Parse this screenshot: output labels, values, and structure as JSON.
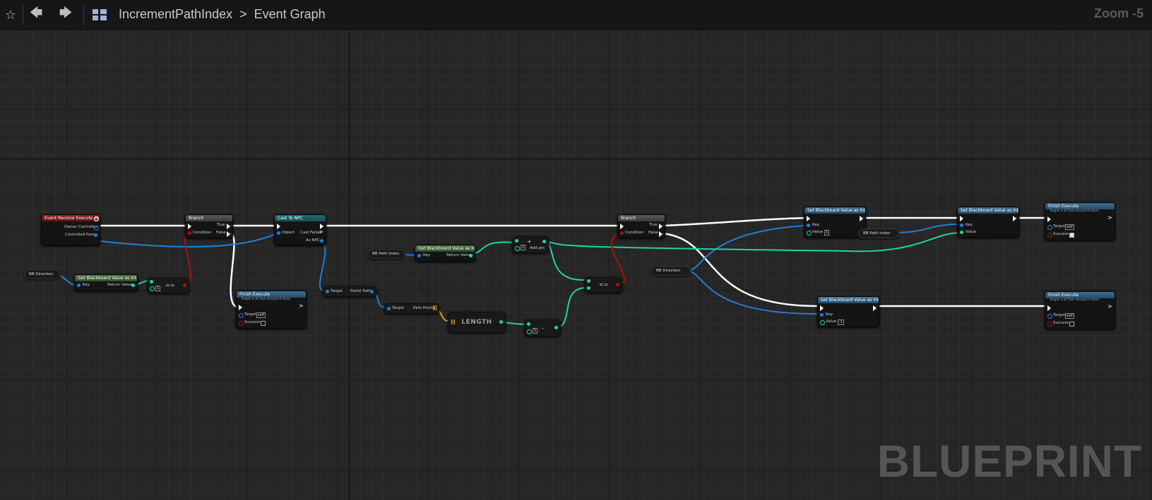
{
  "toolbar": {
    "favorite_icon": "star-icon",
    "back_icon": "arrow-left-icon",
    "forward_icon": "arrow-right-icon",
    "graph_icon": "graph-icon",
    "breadcrumb_root": "IncrementPathIndex",
    "breadcrumb_sep": ">",
    "breadcrumb_leaf": "Event Graph",
    "zoom": "Zoom -5"
  },
  "watermark": "BLUEPRINT",
  "nodes": {
    "event": {
      "title": "Event Receive Execute AI",
      "owner": "Owner Controller",
      "pawn": "Controlled Pawn"
    },
    "bbdir1": {
      "label": "BB Direction"
    },
    "getbb1": {
      "title": "Get Blackboard Value as Int",
      "key": "Key",
      "ret": "Return Value"
    },
    "eq1": {
      "op": "==",
      "val": "1"
    },
    "branch1": {
      "title": "Branch",
      "cond": "Condition",
      "t": "True",
      "f": "False"
    },
    "finish1": {
      "title": "Finish Execute",
      "sub": "Target is BTTask Blueprint Base",
      "target": "Target",
      "self": "self",
      "success": "Success"
    },
    "cast": {
      "title": "Cast To NPC",
      "object": "Object",
      "failed": "Cast Failed",
      "as": "As NPC"
    },
    "patrol": {
      "target": "Target",
      "out": "Patrol Path"
    },
    "pathpts": {
      "target": "Target",
      "out": "Path Points"
    },
    "length": {
      "label": "LENGTH"
    },
    "minus": {
      "op": "-",
      "val": "1"
    },
    "bbpath1": {
      "label": "BB Path Index"
    },
    "getbb2": {
      "title": "Get Blackboard Value as Int",
      "key": "Key",
      "ret": "Return Value"
    },
    "add": {
      "op": "+",
      "val": "1",
      "addpin": "Add pin"
    },
    "le": {
      "op": "<="
    },
    "branch2": {
      "title": "Branch",
      "cond": "Condition",
      "t": "True",
      "f": "False"
    },
    "bbdir2": {
      "label": "BB Direction"
    },
    "setbb1": {
      "title": "Set Blackboard Value as Int",
      "key": "Key",
      "value": "Value",
      "val": "1"
    },
    "bbpath2": {
      "label": "BB Path Index"
    },
    "setbb2": {
      "title": "Set Blackboard Value as Int",
      "key": "Key",
      "value": "Value"
    },
    "setbb3": {
      "title": "Set Blackboard Value as Int",
      "key": "Key",
      "value": "Value",
      "val": "-1"
    },
    "finish2": {
      "title": "Finish Execute",
      "sub": "Target is BTTask Blueprint Base",
      "target": "Target",
      "self": "self",
      "success": "Success"
    },
    "finish3": {
      "title": "Finish Execute",
      "sub": "Target is BTTask Blueprint Base",
      "target": "Target",
      "self": "self",
      "success": "Success"
    }
  },
  "colors": {
    "exec": "#ffffff",
    "object": "#1f7fd6",
    "int": "#1fd4a6",
    "bool": "#a11414",
    "struct": "#d9a40c"
  }
}
